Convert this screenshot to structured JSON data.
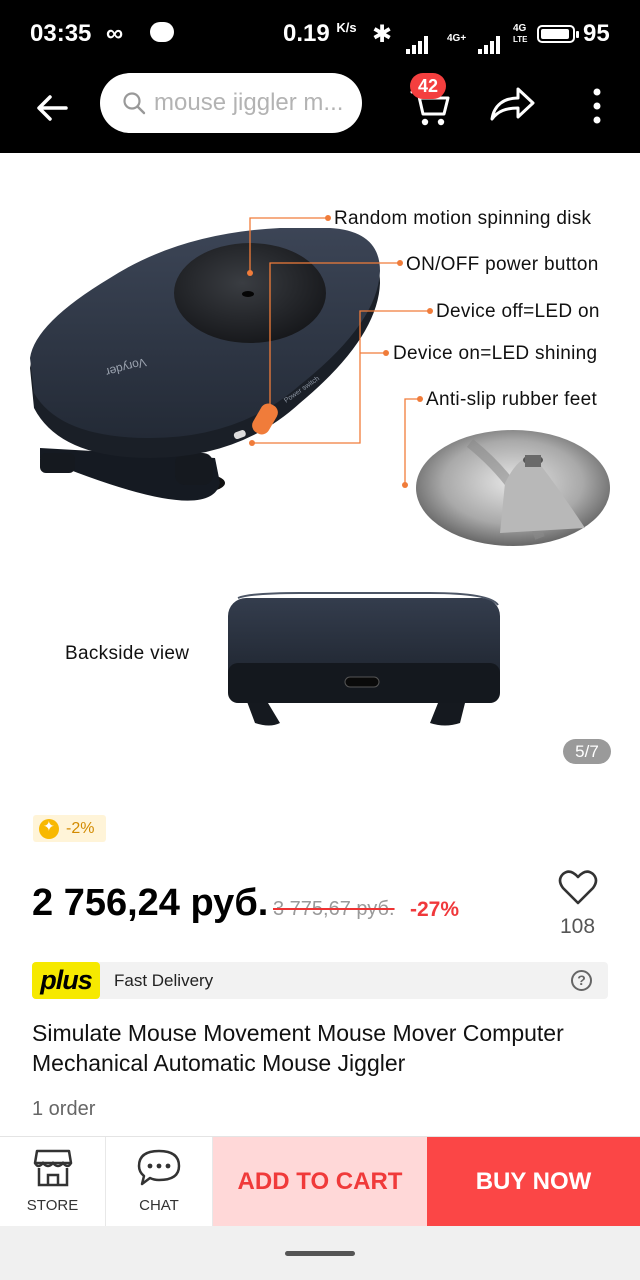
{
  "status_bar": {
    "time": "03:35",
    "speed": "0.19",
    "speed_unit": "K/s",
    "network_1": "4G+",
    "network_2": "4G",
    "network_2_sub": "LTE",
    "battery": "95"
  },
  "header": {
    "search_placeholder": "mouse jiggler m...",
    "cart_count": "42"
  },
  "gallery": {
    "callouts": {
      "spinning_disk": "Random motion spinning disk",
      "power_button": "ON/OFF power button",
      "device_off": "Device off=LED on",
      "device_on": "Device on=LED shining",
      "rubber_feet": "Anti-slip rubber feet",
      "backside": "Backside view"
    },
    "device_brand": "Voryder",
    "power_label": "Power switch",
    "counter": "5/7"
  },
  "product": {
    "coin_discount": "-2%",
    "price": "2 756,24 руб.",
    "old_price": "3 775,67 руб.",
    "discount": "-27%",
    "wishlist_count": "108",
    "plus_logo": "plus",
    "delivery": "Fast Delivery",
    "title": "Simulate Mouse Movement Mouse Mover Computer Mechanical Automatic Mouse Jiggler",
    "orders": "1 order"
  },
  "bottom_bar": {
    "store": "STORE",
    "chat": "CHAT",
    "add_to_cart": "ADD TO CART",
    "buy_now": "BUY NOW"
  },
  "colors": {
    "accent_red": "#fb4646",
    "cart_bg": "#ffd8d8",
    "plus_yellow": "#f6e900",
    "callout_orange": "#f07c3a"
  }
}
